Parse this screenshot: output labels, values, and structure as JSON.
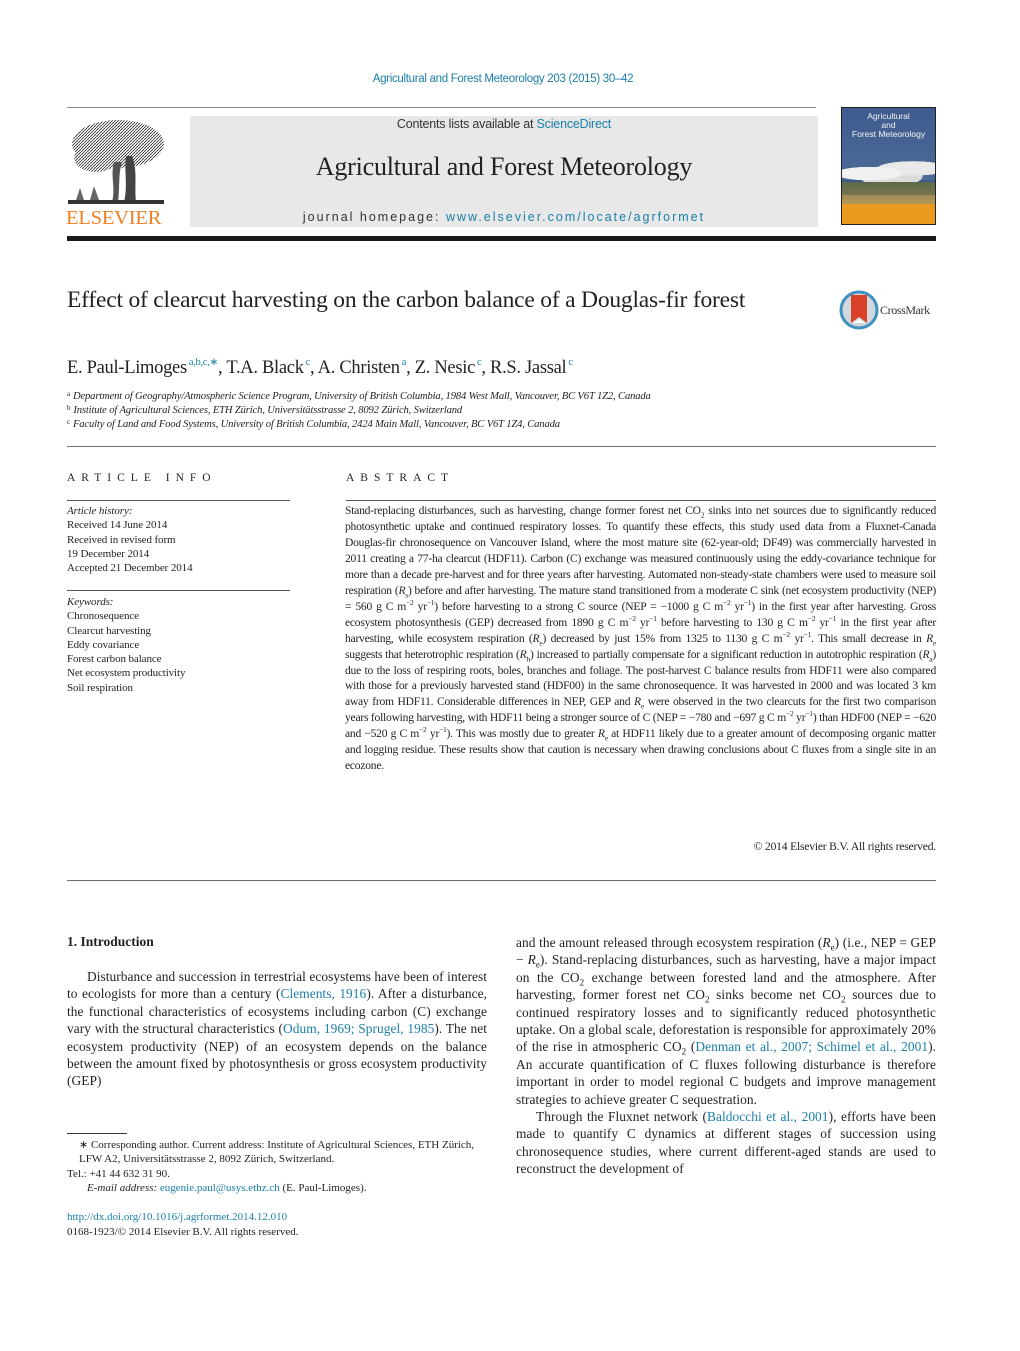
{
  "header": {
    "citation": "Agricultural and Forest Meteorology 203 (2015) 30–42",
    "publisher": "ELSEVIER",
    "contents_prefix": "Contents lists available at ",
    "contents_link": "ScienceDirect",
    "journal_title": "Agricultural and Forest Meteorology",
    "homepage_prefix": "journal homepage: ",
    "homepage_link": "www.elsevier.com/locate/agrformet",
    "cover_title_lines": [
      "Agricultural",
      "and",
      "Forest Meteorology"
    ],
    "brand_color": "#f07f22",
    "link_color": "#1a7fa8"
  },
  "article": {
    "title": "Effect of clearcut harvesting on the carbon balance of a Douglas-fir forest",
    "crossmark_label": "CrossMark",
    "authors": [
      {
        "name": "E. Paul-Limoges",
        "affil": "a,b,c,∗"
      },
      {
        "name": "T.A. Black",
        "affil": "c"
      },
      {
        "name": "A. Christen",
        "affil": "a"
      },
      {
        "name": "Z. Nesic",
        "affil": "c"
      },
      {
        "name": "R.S. Jassal",
        "affil": "c"
      }
    ],
    "affiliations": [
      {
        "key": "a",
        "text": "Department of Geography/Atmospheric Science Program, University of British Columbia, 1984 West Mall, Vancouver, BC V6T 1Z2, Canada"
      },
      {
        "key": "b",
        "text": "Institute of Agricultural Sciences, ETH Zürich, Universitätsstrasse 2, 8092 Zürich, Switzerland"
      },
      {
        "key": "c",
        "text": "Faculty of Land and Food Systems, University of British Columbia, 2424 Main Mall, Vancouver, BC V6T 1Z4, Canada"
      }
    ]
  },
  "article_info": {
    "heading": "ARTICLE INFO",
    "history_label": "Article history:",
    "history": [
      "Received 14 June 2014",
      "Received in revised form",
      "19 December 2014",
      "Accepted 21 December 2014"
    ],
    "keywords_label": "Keywords:",
    "keywords": [
      "Chronosequence",
      "Clearcut harvesting",
      "Eddy covariance",
      "Forest carbon balance",
      "Net ecosystem productivity",
      "Soil respiration"
    ]
  },
  "abstract": {
    "heading": "ABSTRACT",
    "segments": [
      {
        "t": "Stand-replacing disturbances, such as harvesting, change former forest net CO"
      },
      {
        "sub": "2"
      },
      {
        "t": " sinks into net sources due to significantly reduced photosynthetic uptake and continued respiratory losses. To quantify these effects, this study used data from a Fluxnet-Canada Douglas-fir chronosequence on Vancouver Island, where the most mature site (62-year-old; DF49) was commercially harvested in 2011 creating a 77-ha clearcut (HDF11). Carbon (C) exchange was measured continuously using the eddy-covariance technique for more than a decade pre-harvest and for three years after harvesting. Automated non-steady-state chambers were used to measure soil respiration ("
      },
      {
        "i": "R"
      },
      {
        "sub": "s"
      },
      {
        "t": ") before and after harvesting. The mature stand transitioned from a moderate C sink (net ecosystem productivity (NEP) = 560 g C m"
      },
      {
        "sup": "−2"
      },
      {
        "t": " yr"
      },
      {
        "sup": "−1"
      },
      {
        "t": ") before harvesting to a strong C source (NEP = −1000 g C m"
      },
      {
        "sup": "−2"
      },
      {
        "t": " yr"
      },
      {
        "sup": "−1"
      },
      {
        "t": ") in the first year after harvesting. Gross ecosystem photosynthesis (GEP) decreased from 1890 g C m"
      },
      {
        "sup": "−2"
      },
      {
        "t": " yr"
      },
      {
        "sup": "−1"
      },
      {
        "t": " before harvesting to 130 g C m"
      },
      {
        "sup": "−2"
      },
      {
        "t": " yr"
      },
      {
        "sup": "−1"
      },
      {
        "t": " in the first year after harvesting, while ecosystem respiration ("
      },
      {
        "i": "R"
      },
      {
        "sub": "e"
      },
      {
        "t": ") decreased by just 15% from 1325 to 1130 g C m"
      },
      {
        "sup": "−2"
      },
      {
        "t": " yr"
      },
      {
        "sup": "−1"
      },
      {
        "t": ". This small decrease in "
      },
      {
        "i": "R"
      },
      {
        "sub": "e"
      },
      {
        "t": " suggests that heterotrophic respiration ("
      },
      {
        "i": "R"
      },
      {
        "sub": "h"
      },
      {
        "t": ") increased to partially compensate for a significant reduction in autotrophic respiration ("
      },
      {
        "i": "R"
      },
      {
        "sub": "a"
      },
      {
        "t": ") due to the loss of respiring roots, boles, branches and foliage. The post-harvest C balance results from HDF11 were also compared with those for a previously harvested stand (HDF00) in the same chronosequence. It was harvested in 2000 and was located 3 km away from HDF11. Considerable differences in NEP, GEP and "
      },
      {
        "i": "R"
      },
      {
        "sub": "e"
      },
      {
        "t": " were observed in the two clearcuts for the first two comparison years following harvesting, with HDF11 being a stronger source of C (NEP = −780 and −697 g C m"
      },
      {
        "sup": "−2"
      },
      {
        "t": " yr"
      },
      {
        "sup": "−1"
      },
      {
        "t": ") than HDF00 (NEP = −620 and −520 g C m"
      },
      {
        "sup": "−2"
      },
      {
        "t": " yr"
      },
      {
        "sup": "−1"
      },
      {
        "t": "). This was mostly due to greater "
      },
      {
        "i": "R"
      },
      {
        "sub": "e"
      },
      {
        "t": " at HDF11 likely due to a greater amount of decomposing organic matter and logging residue. These results show that caution is necessary when drawing conclusions about C fluxes from a single site in an ecozone."
      }
    ],
    "copyright": "© 2014 Elsevier B.V. All rights reserved."
  },
  "body": {
    "intro_heading": "1.  Introduction",
    "left_paragraphs": [
      [
        {
          "t": "Disturbance and succession in terrestrial ecosystems have been of interest to ecologists for more than a century ("
        },
        {
          "link": "Clements, 1916"
        },
        {
          "t": "). After a disturbance, the functional characteristics of ecosystems including carbon (C) exchange vary with the structural characteristics ("
        },
        {
          "link": "Odum, 1969; Sprugel, 1985"
        },
        {
          "t": "). The net ecosystem productivity (NEP) of an ecosystem depends on the balance between the amount fixed by photosynthesis or gross ecosystem productivity (GEP)"
        }
      ]
    ],
    "right_paragraphs": [
      [
        {
          "t": "and the amount released through ecosystem respiration ("
        },
        {
          "i": "R"
        },
        {
          "sub": "e"
        },
        {
          "t": ") (i.e., NEP = GEP − "
        },
        {
          "i": "R"
        },
        {
          "sub": "e"
        },
        {
          "t": "). Stand-replacing disturbances, such as harvesting, have a major impact on the CO"
        },
        {
          "sub": "2"
        },
        {
          "t": " exchange between forested land and the atmosphere. After harvesting, former forest net CO"
        },
        {
          "sub": "2"
        },
        {
          "t": " sinks become net CO"
        },
        {
          "sub": "2"
        },
        {
          "t": " sources due to continued respiratory losses and to significantly reduced photosynthetic uptake. On a global scale, deforestation is responsible for approximately 20% of the rise in atmospheric CO"
        },
        {
          "sub": "2"
        },
        {
          "t": " ("
        },
        {
          "link": "Denman et al., 2007; Schimel et al., 2001"
        },
        {
          "t": "). An accurate quantification of C fluxes following disturbance is therefore important in order to model regional C budgets and improve management strategies to achieve greater C sequestration."
        }
      ],
      [
        {
          "t": "Through the Fluxnet network ("
        },
        {
          "link": "Baldocchi et al., 2001"
        },
        {
          "t": "), efforts have been made to quantify C dynamics at different stages of succession using chronosequence studies, where current different-aged stands are used to reconstruct the development of"
        }
      ]
    ]
  },
  "footnotes": {
    "corresponding": "∗  Corresponding author. Current address: Institute of Agricultural Sciences, ETH Zürich, LFW A2, Universitätsstrasse 2, 8092 Zürich, Switzerland.",
    "tel": "Tel.: +41 44 632 31 90.",
    "email_label": "E-mail address: ",
    "email": "eugenie.paul@usys.ethz.ch",
    "email_suffix": " (E. Paul-Limoges).",
    "doi": "http://dx.doi.org/10.1016/j.agrformet.2014.12.010",
    "issn": "0168-1923/© 2014 Elsevier B.V. All rights reserved."
  }
}
